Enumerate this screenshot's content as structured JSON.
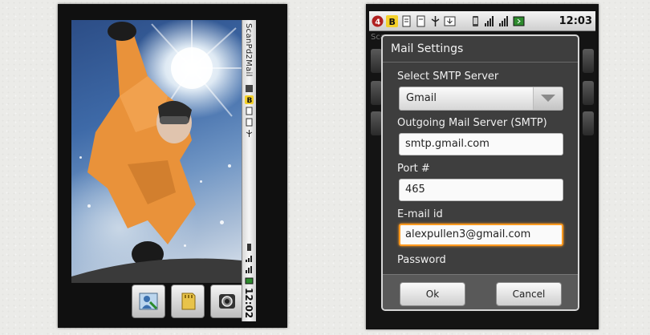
{
  "left_phone": {
    "app_title": "ScanPd2Mail",
    "clock": "12:02",
    "controls": [
      {
        "name": "gallery-button",
        "icon": "gallery-person-icon"
      },
      {
        "name": "sd-card-button",
        "icon": "sd-card-icon"
      },
      {
        "name": "shutter-button",
        "icon": "camera-shutter-icon"
      }
    ]
  },
  "right_phone": {
    "status_bar": {
      "notification_count": "4",
      "badge_letter": "B",
      "clock": "12:03"
    },
    "app_title_peek": "Sca",
    "dialog": {
      "title": "Mail Settings",
      "smtp_server_label": "Select SMTP Server",
      "smtp_server_value": "Gmail",
      "outgoing_label": "Outgoing Mail Server (SMTP)",
      "outgoing_value": "smtp.gmail.com",
      "port_label": "Port #",
      "port_value": "465",
      "email_label": "E-mail id",
      "email_value": "alexpullen3@gmail.com",
      "password_label": "Password",
      "ok_label": "Ok",
      "cancel_label": "Cancel"
    }
  },
  "colors": {
    "focus": "#ff9a1f",
    "dialog_bg": "#3e3e3e",
    "status_bar": "#e6e6e6"
  }
}
